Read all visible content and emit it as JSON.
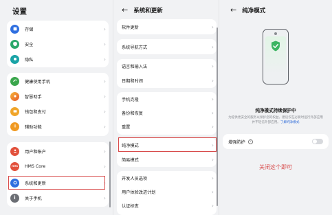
{
  "left": {
    "title": "设置",
    "groups": [
      [
        {
          "label": "存储",
          "icon": "storage-icon",
          "color": "#2f6fe0"
        },
        {
          "label": "安全",
          "icon": "security-icon",
          "color": "#2aa86a"
        },
        {
          "label": "隐私",
          "icon": "privacy-icon",
          "color": "#19a3a6"
        }
      ],
      [
        {
          "label": "健康使用手机",
          "icon": "health-icon",
          "color": "#3aa64c"
        },
        {
          "label": "智慧助手",
          "icon": "assistant-icon",
          "color": "#f08a2a"
        },
        {
          "label": "钱包和支付",
          "icon": "wallet-icon",
          "color": "#f0a52a"
        },
        {
          "label": "辅助功能",
          "icon": "accessibility-icon",
          "color": "#f09a22"
        }
      ],
      [
        {
          "label": "用户和帐户",
          "icon": "user-icon",
          "color": "#e2513c"
        },
        {
          "label": "HMS Core",
          "icon": "hms-core-icon",
          "color": "#e2513c"
        },
        {
          "label": "系统和更新",
          "icon": "system-update-icon",
          "color": "#2f6fe0"
        },
        {
          "label": "关于手机",
          "icon": "about-phone-icon",
          "color": "#6b6e74"
        }
      ]
    ]
  },
  "mid": {
    "title": "系统和更新",
    "groups": [
      [
        "软件更新"
      ],
      [
        "系统导航方式"
      ],
      [
        "语言和输入法",
        "日期和时间"
      ],
      [
        "手机克隆",
        "备份和恢复",
        "重置"
      ],
      [
        "纯净模式",
        "简易模式"
      ],
      [
        "开发人员选项",
        "用户体验改进计划",
        "认证标志"
      ]
    ]
  },
  "right": {
    "title": "纯净模式",
    "status_title": "纯净模式持续保护中",
    "description": "为提供更安全的服务以保护您的权益，建议仅在必要时运行外部应用并不轻信外部应用。",
    "link_text": "了解纯净模式",
    "enhance_label": "增强防护",
    "enhance_on": false,
    "annotation": "关闭这个即可"
  },
  "colors": {
    "highlight": "#d84a4a",
    "link": "#2e6bd8",
    "shield": "#3cb563"
  }
}
